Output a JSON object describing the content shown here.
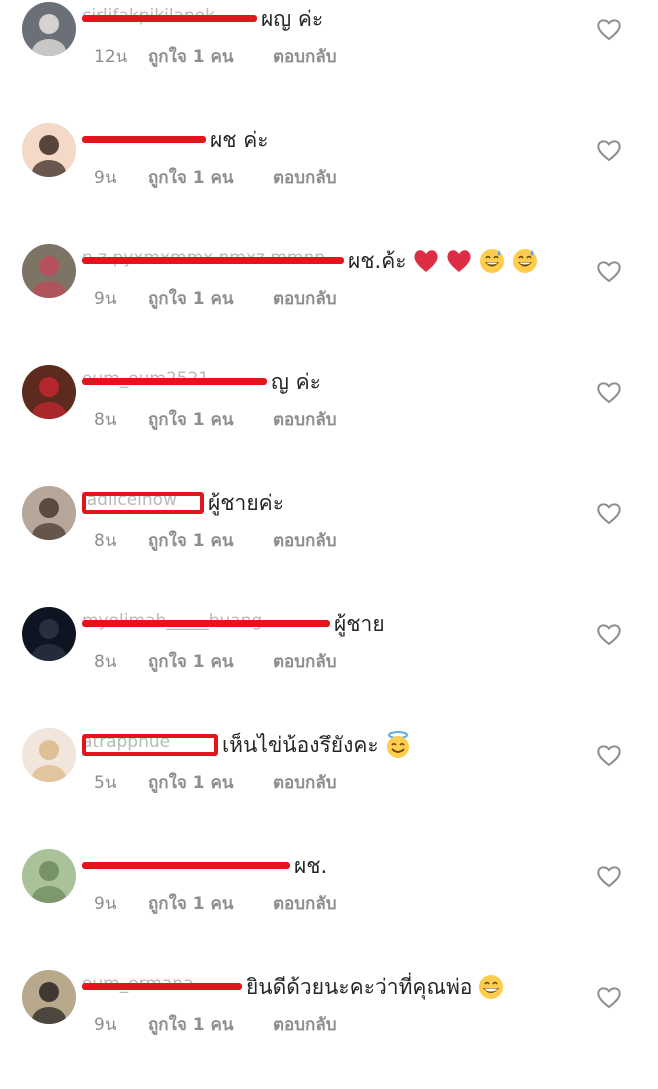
{
  "comments": [
    {
      "username": "cirlifakpikilanok",
      "text": "ผญ ค่ะ",
      "time": "12น",
      "likes": "ถูกใจ 1 คน",
      "reply": "ตอบกลับ",
      "emojis": [],
      "redact": "line",
      "avatar_colors": [
        "#6b6f78",
        "#e7e4df"
      ]
    },
    {
      "username": "",
      "text": "ผช ค่ะ",
      "time": "9น",
      "likes": "ถูกใจ 1 คน",
      "reply": "ตอบกลับ",
      "emojis": [],
      "redact": "line",
      "avatar_colors": [
        "#f4d9c6",
        "#3b2a24"
      ]
    },
    {
      "username": "n.z.pyxmxmmx.nmxz.mmnn",
      "text": "ผช.ค้ะ",
      "time": "9น",
      "likes": "ถูกใจ 1 คน",
      "reply": "ตอบกลับ",
      "emojis": [
        "red-heart-emoji",
        "red-heart-emoji",
        "grinning-sweat-emoji",
        "grinning-sweat-emoji"
      ],
      "redact": "line",
      "avatar_colors": [
        "#7e7466",
        "#c04a5a"
      ]
    },
    {
      "username": "oum_oum2521",
      "text": "ญ ค่ะ",
      "time": "8น",
      "likes": "ถูกใจ 1 คน",
      "reply": "ตอบกลับ",
      "emojis": [],
      "redact": "line",
      "avatar_colors": [
        "#5c2a1e",
        "#c3272f"
      ]
    },
    {
      "username": "ladiicelnow",
      "text": "ผู้ชายค่ะ",
      "time": "8น",
      "likes": "ถูกใจ 1 คน",
      "reply": "ตอบกลับ",
      "emojis": [],
      "redact": "box",
      "avatar_colors": [
        "#b7a79b",
        "#4a3a30"
      ]
    },
    {
      "username": "myolimah_____buang",
      "text": "ผู้ชาย",
      "time": "8น",
      "likes": "ถูกใจ 1 คน",
      "reply": "ตอบกลับ",
      "emojis": [],
      "redact": "line",
      "avatar_colors": [
        "#0e1422",
        "#2c3446"
      ]
    },
    {
      "username": "atrappnue",
      "text": "เห็นไข่น้องรึยังคะ",
      "time": "5น",
      "likes": "ถูกใจ 1 คน",
      "reply": "ตอบกลับ",
      "emojis": [
        "smiling-halo-emoji"
      ],
      "redact": "box",
      "avatar_colors": [
        "#f2e6dc",
        "#d9b98a"
      ]
    },
    {
      "username": "",
      "text": "ผช.",
      "time": "9น",
      "likes": "ถูกใจ 1 คน",
      "reply": "ตอบกลับ",
      "emojis": [],
      "redact": "line",
      "avatar_colors": [
        "#a9c29a",
        "#6e8a5c"
      ]
    },
    {
      "username": "oum_ormana",
      "text": "ยินดีด้วยนะคะว่าที่คุณพ่อ",
      "time": "9น",
      "likes": "ถูกใจ 1 คน",
      "reply": "ตอบกลับ",
      "emojis": [
        "beaming-grin-emoji"
      ],
      "redact": "line",
      "avatar_colors": [
        "#b9a98c",
        "#2a2622"
      ]
    }
  ],
  "colors": {
    "redaction": "#e3141c",
    "meta_text": "#8e8e8e",
    "body_text": "#262626",
    "heart_outline": "#8e8e8e"
  },
  "icons": {
    "like": "heart-outline-icon"
  }
}
